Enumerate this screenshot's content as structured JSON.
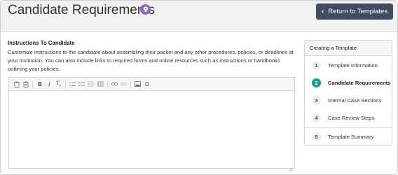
{
  "header": {
    "title": "Candidate Requirements",
    "return_button": "Return to Templates"
  },
  "instructions": {
    "title": "Instructions To Candidate",
    "description": "Customize instructions to the candidate about assembling their packet and any other procedures, policies, or deadlines at your institution. You can also include links to required forms and online resources such as instructions or handbooks outlining your policies."
  },
  "editor": {
    "toolbar_icons": [
      "paste-icon",
      "paste-text-icon",
      "bold-icon",
      "italic-icon",
      "remove-format-icon",
      "numbered-list-icon",
      "bulleted-list-icon",
      "outdent-icon",
      "indent-icon",
      "link-icon",
      "unlink-icon",
      "image-icon",
      "special-character-icon"
    ],
    "content": ""
  },
  "steps_panel": {
    "title": "Creating a Template",
    "steps": [
      {
        "number": "1",
        "label": "Template Information",
        "active": false
      },
      {
        "number": "2",
        "label": "Candidate Requirements",
        "active": true
      },
      {
        "number": "3",
        "label": "Internal Case Sections",
        "active": false
      },
      {
        "number": "4",
        "label": "Case Review Steps",
        "active": false
      },
      {
        "number": "5",
        "label": "Template Summary",
        "active": false
      }
    ]
  },
  "colors": {
    "active_step": "#1f9a8c",
    "return_button": "#3f4c63",
    "pin_badge": "#8e6bb5"
  }
}
